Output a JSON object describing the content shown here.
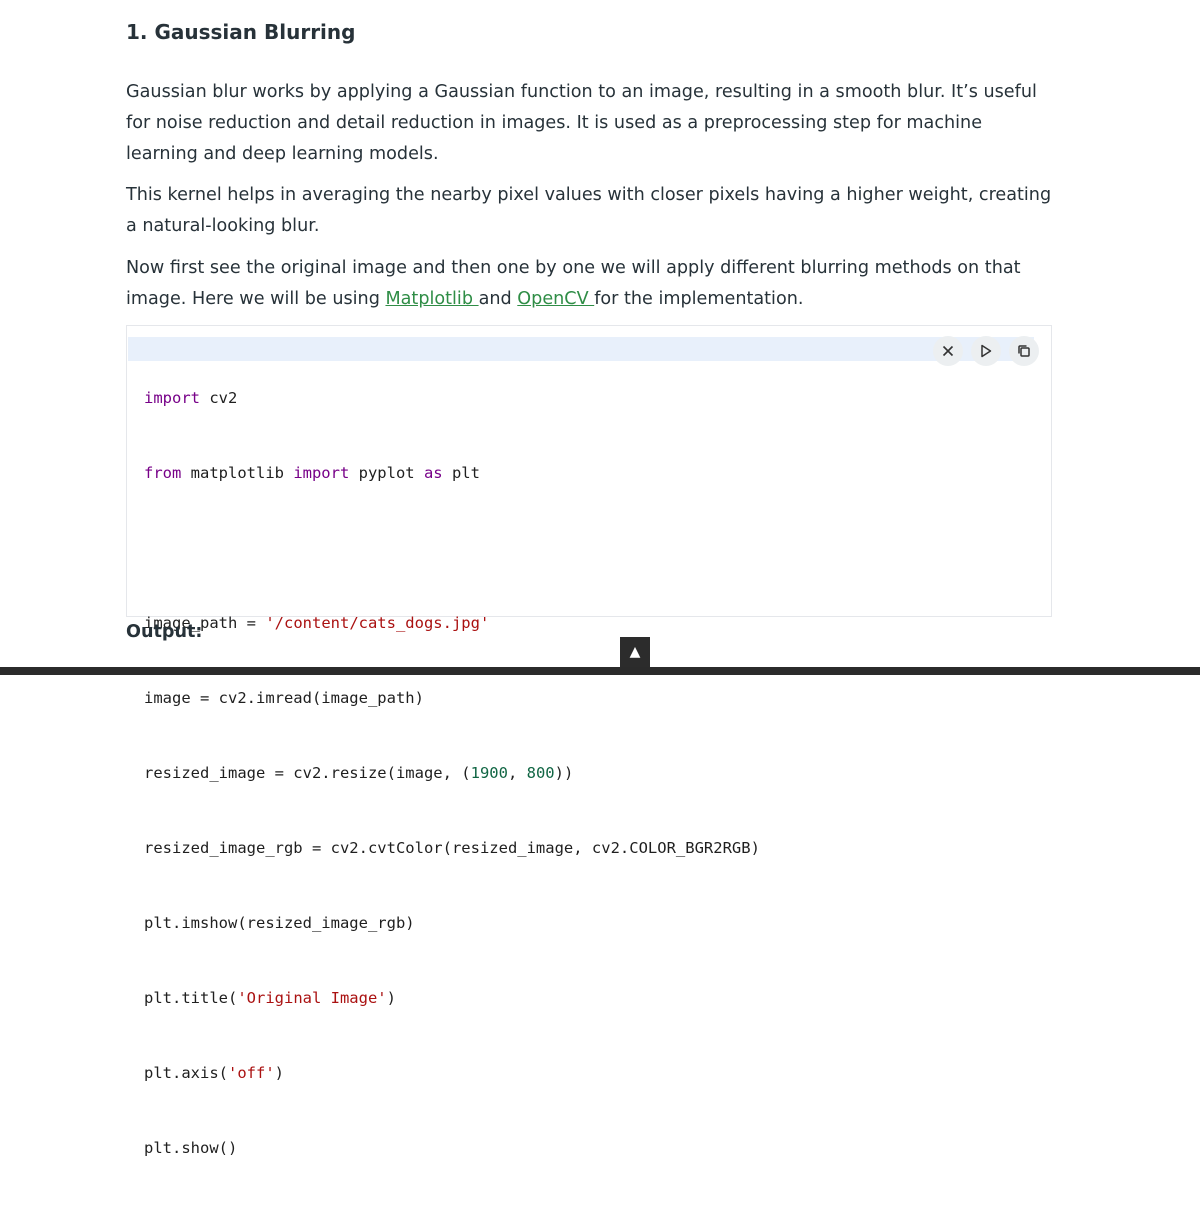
{
  "section": {
    "title": "1. Gaussian Blurring"
  },
  "paragraphs": {
    "p1": "Gaussian blur works by applying a Gaussian function to an image, resulting in a smooth blur. It’s useful for noise reduction and detail reduction in images. It is used as a preprocessing step for machine learning and deep learning models.",
    "p2": "This kernel helps in averaging the nearby pixel values with closer pixels having a higher weight, creating a natural-looking blur.",
    "p3_part1": "Now first see the original image and then one by one we will apply different blurring methods on that image. Here we will be using ",
    "p3_link1": "Matplotlib ",
    "p3_part2": "and ",
    "p3_link2": "OpenCV ",
    "p3_part3": "for the implementation."
  },
  "code": {
    "line1": [
      {
        "t": "import",
        "c": "kw"
      },
      {
        "t": " cv2",
        "c": ""
      }
    ],
    "line2": [
      {
        "t": "from",
        "c": "kw"
      },
      {
        "t": " matplotlib ",
        "c": ""
      },
      {
        "t": "import",
        "c": "kw"
      },
      {
        "t": " pyplot ",
        "c": ""
      },
      {
        "t": "as",
        "c": "kw"
      },
      {
        "t": " plt",
        "c": ""
      }
    ],
    "line3": [
      {
        "t": "",
        "c": ""
      }
    ],
    "line4": [
      {
        "t": "image_path = ",
        "c": ""
      },
      {
        "t": "'/content/cats_dogs.jpg'",
        "c": "str"
      }
    ],
    "line5": [
      {
        "t": "image = cv2.imread(image_path)",
        "c": ""
      }
    ],
    "line6": [
      {
        "t": "resized_image = cv2.resize(image, (",
        "c": ""
      },
      {
        "t": "1900",
        "c": "num"
      },
      {
        "t": ", ",
        "c": ""
      },
      {
        "t": "800",
        "c": "num"
      },
      {
        "t": "))",
        "c": ""
      }
    ],
    "line7": [
      {
        "t": "resized_image_rgb = cv2.cvtColor(resized_image, cv2.COLOR_BGR2RGB)",
        "c": ""
      }
    ],
    "line8": [
      {
        "t": "plt.imshow(resized_image_rgb)",
        "c": ""
      }
    ],
    "line9": [
      {
        "t": "plt.title(",
        "c": ""
      },
      {
        "t": "'Original Image'",
        "c": "str"
      },
      {
        "t": ")",
        "c": ""
      }
    ],
    "line10": [
      {
        "t": "plt.axis(",
        "c": ""
      },
      {
        "t": "'off'",
        "c": "str"
      },
      {
        "t": ")",
        "c": ""
      }
    ],
    "line11": [
      {
        "t": "plt.show()",
        "c": ""
      }
    ]
  },
  "code_tools": {
    "close_icon": "close-icon",
    "run_icon": "play-icon",
    "copy_icon": "copy-icon"
  },
  "output": {
    "label": "Output:"
  },
  "scroll_top": {
    "glyph": "▲"
  },
  "colors": {
    "link": "#2f8d46",
    "keyword": "#770088",
    "string": "#aa1111",
    "number": "#116644",
    "highlight": "#e8f0fb"
  }
}
